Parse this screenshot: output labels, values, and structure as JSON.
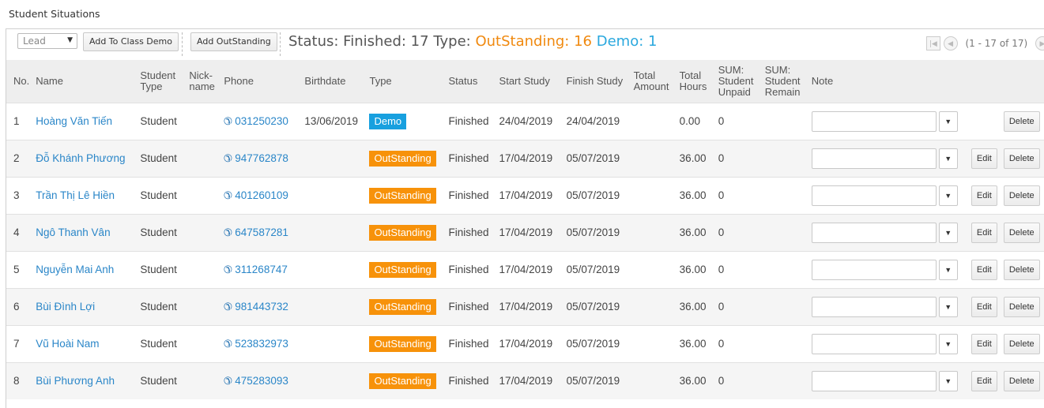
{
  "page_title": "Student Situations",
  "toolbar": {
    "lead_value": "Lead",
    "add_to_class_demo": "Add To Class Demo",
    "add_outstanding": "Add OutStanding",
    "summary_status": "Status: Finished: 17",
    "summary_type_label": "Type:",
    "summary_outstanding": "OutStanding: 16",
    "summary_demo": "Demo: 1",
    "pager_range": "(1 - 17 of 17)"
  },
  "colors": {
    "outstanding": "#f7920a",
    "demo": "#18a0df",
    "link": "#2a86c8"
  },
  "columns": {
    "no": "No.",
    "name": "Name",
    "student_type_1": "Student",
    "student_type_2": "Type",
    "nick_1": "Nick-",
    "nick_2": "name",
    "phone": "Phone",
    "birthdate": "Birthdate",
    "type": "Type",
    "status": "Status",
    "start": "Start Study",
    "finish": "Finish Study",
    "total_amount_1": "Total",
    "total_amount_2": "Amount",
    "total_hours_1": "Total",
    "total_hours_2": "Hours",
    "unpaid_1": "SUM:",
    "unpaid_2": "Student",
    "unpaid_3": "Unpaid",
    "remain_1": "SUM:",
    "remain_2": "Student",
    "remain_3": "Remain",
    "note": "Note"
  },
  "row_actions": {
    "edit": "Edit",
    "delete": "Delete"
  },
  "rows": [
    {
      "no": "1",
      "name": "Hoàng Văn Tiến",
      "student_type": "Student",
      "phone": "031250230",
      "birthdate": "13/06/2019",
      "type": "Demo",
      "status": "Finished",
      "start": "24/04/2019",
      "finish": "24/04/2019",
      "total_hours": "0.00",
      "unpaid": "0",
      "has_edit": false
    },
    {
      "no": "2",
      "name": "Đỗ Khánh Phương",
      "student_type": "Student",
      "phone": "947762878",
      "birthdate": "",
      "type": "OutStanding",
      "status": "Finished",
      "start": "17/04/2019",
      "finish": "05/07/2019",
      "total_hours": "36.00",
      "unpaid": "0",
      "has_edit": true
    },
    {
      "no": "3",
      "name": "Trần Thị Lê Hiền",
      "student_type": "Student",
      "phone": "401260109",
      "birthdate": "",
      "type": "OutStanding",
      "status": "Finished",
      "start": "17/04/2019",
      "finish": "05/07/2019",
      "total_hours": "36.00",
      "unpaid": "0",
      "has_edit": true
    },
    {
      "no": "4",
      "name": "Ngô Thanh Vân",
      "student_type": "Student",
      "phone": "647587281",
      "birthdate": "",
      "type": "OutStanding",
      "status": "Finished",
      "start": "17/04/2019",
      "finish": "05/07/2019",
      "total_hours": "36.00",
      "unpaid": "0",
      "has_edit": true
    },
    {
      "no": "5",
      "name": "Nguyễn Mai Anh",
      "student_type": "Student",
      "phone": "311268747",
      "birthdate": "",
      "type": "OutStanding",
      "status": "Finished",
      "start": "17/04/2019",
      "finish": "05/07/2019",
      "total_hours": "36.00",
      "unpaid": "0",
      "has_edit": true
    },
    {
      "no": "6",
      "name": "Bùi Đình Lợi",
      "student_type": "Student",
      "phone": "981443732",
      "birthdate": "",
      "type": "OutStanding",
      "status": "Finished",
      "start": "17/04/2019",
      "finish": "05/07/2019",
      "total_hours": "36.00",
      "unpaid": "0",
      "has_edit": true
    },
    {
      "no": "7",
      "name": "Vũ Hoài Nam",
      "student_type": "Student",
      "phone": "523832973",
      "birthdate": "",
      "type": "OutStanding",
      "status": "Finished",
      "start": "17/04/2019",
      "finish": "05/07/2019",
      "total_hours": "36.00",
      "unpaid": "0",
      "has_edit": true
    },
    {
      "no": "8",
      "name": "Bùi Phương Anh",
      "student_type": "Student",
      "phone": "475283093",
      "birthdate": "",
      "type": "OutStanding",
      "status": "Finished",
      "start": "17/04/2019",
      "finish": "05/07/2019",
      "total_hours": "36.00",
      "unpaid": "0",
      "has_edit": true
    }
  ]
}
